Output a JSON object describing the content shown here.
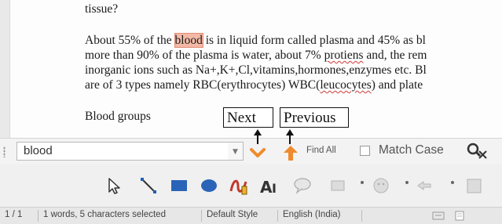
{
  "document": {
    "line_top": "tissue?",
    "para_prefix": "About 55% of the ",
    "highlight_word": "blood",
    "para_line1_rest": " is in liquid form called plasma and 45% as bl",
    "para_line2_a": "more than 90% of the plasma is water, about 7% ",
    "para_line2_misspelled": "protiens",
    "para_line2_b": " and, the rem",
    "para_line3": "inorganic ions such as Na+,K+,Cl,vitamins,hormones,enzymes etc. Bl",
    "para_line4_a": "are of 3 types namely RBC(erythrocytes) WBC(",
    "para_line4_misspelled": "leucocytes",
    "para_line4_b": ") and plate",
    "heading": "Blood groups"
  },
  "callouts": {
    "next": "Next",
    "previous": "Previous"
  },
  "findbar": {
    "search_value": "blood",
    "dropdown_glyph": "▼",
    "find_all_label": "Find All",
    "match_case_label": "Match Case",
    "match_case_checked": false
  },
  "drawbar": {
    "icons": [
      "select-arrow-icon",
      "line-icon",
      "rectangle-icon",
      "ellipse-icon",
      "freeform-icon",
      "fontwork-icon",
      "callout-icon",
      "basic-shapes-icon",
      "symbol-shapes-icon",
      "block-arrows-icon",
      "extrusion-icon"
    ]
  },
  "statusbar": {
    "page": "1 / 1",
    "word_count": "1 words, 5 characters selected",
    "page_style": "Default Style",
    "language": "English (India)"
  },
  "colors": {
    "highlight": "#f4b9a6",
    "nav_arrow": "#f08a2c",
    "toolbar_bg": "#f3f3f3"
  }
}
